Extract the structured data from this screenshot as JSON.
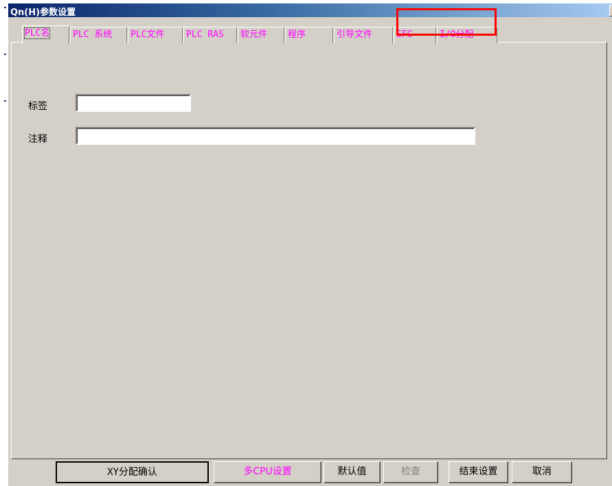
{
  "window": {
    "title": "Qn(H)参数设置",
    "close_glyph": "x"
  },
  "tabs": [
    {
      "label": "PLC名",
      "active": true
    },
    {
      "label": "PLC 系统"
    },
    {
      "label": "PLC文件"
    },
    {
      "label": "PLC RAS"
    },
    {
      "label": "软元件"
    },
    {
      "label": "程序"
    },
    {
      "label": "引导文件"
    },
    {
      "label": "SFC"
    },
    {
      "label": "I/O分配"
    }
  ],
  "form": {
    "label_field": {
      "label": "标签",
      "value": ""
    },
    "comment_field": {
      "label": "注释",
      "value": ""
    }
  },
  "buttons": {
    "xy_confirm": "XY分配确认",
    "multi_cpu": "多CPU设置",
    "default": "默认值",
    "check": "检查",
    "finish": "结束设置",
    "cancel": "取消"
  },
  "colors": {
    "tab_text": "#ff00ff",
    "highlight": "#ff0000",
    "title_bar": "#0a246a",
    "face": "#d4d0c8"
  }
}
